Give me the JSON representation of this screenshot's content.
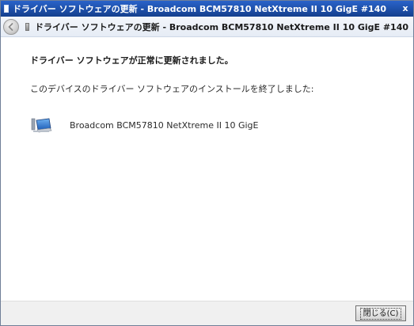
{
  "window": {
    "title": "ドライバー ソフトウェアの更新 - Broadcom BCM57810 NetXtreme II 10 GigE #140",
    "close_glyph": "x"
  },
  "nav": {
    "title": "ドライバー ソフトウェアの更新 - Broadcom BCM57810 NetXtreme II 10 GigE #140"
  },
  "content": {
    "heading": "ドライバー ソフトウェアが正常に更新されました。",
    "message": "このデバイスのドライバー ソフトウェアのインストールを終了しました:",
    "device_name": "Broadcom BCM57810 NetXtreme II 10 GigE"
  },
  "footer": {
    "close_label": "閉じる(C)"
  },
  "icons": {
    "app": "driver-icon",
    "back": "back-arrow-icon",
    "nav_device": "driver-icon",
    "device": "network-adapter-icon"
  },
  "colors": {
    "titlebar": "#1d4fa8",
    "nav_background": "#eaeff7",
    "footer_background": "#f0f0f0"
  }
}
